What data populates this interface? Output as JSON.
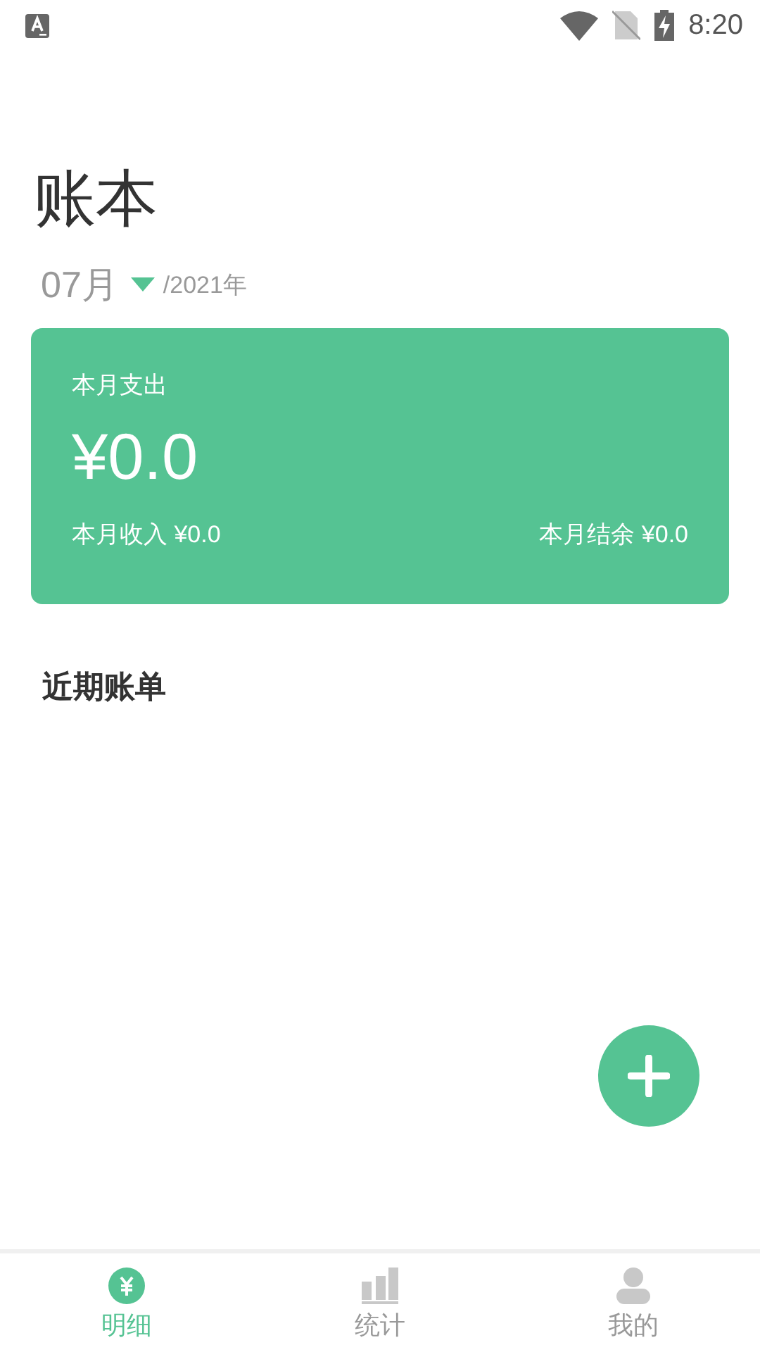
{
  "status_bar": {
    "time": "8:20"
  },
  "title": "账本",
  "period": {
    "month": "07月",
    "year": "/2021年"
  },
  "summary": {
    "label": "本月支出",
    "amount": "¥0.0",
    "income": "本月收入 ¥0.0",
    "balance": "本月结余 ¥0.0"
  },
  "section_title": "近期账单",
  "tabs": [
    {
      "label": "明细",
      "selected": true
    },
    {
      "label": "统计",
      "selected": false
    },
    {
      "label": "我的",
      "selected": false
    }
  ]
}
